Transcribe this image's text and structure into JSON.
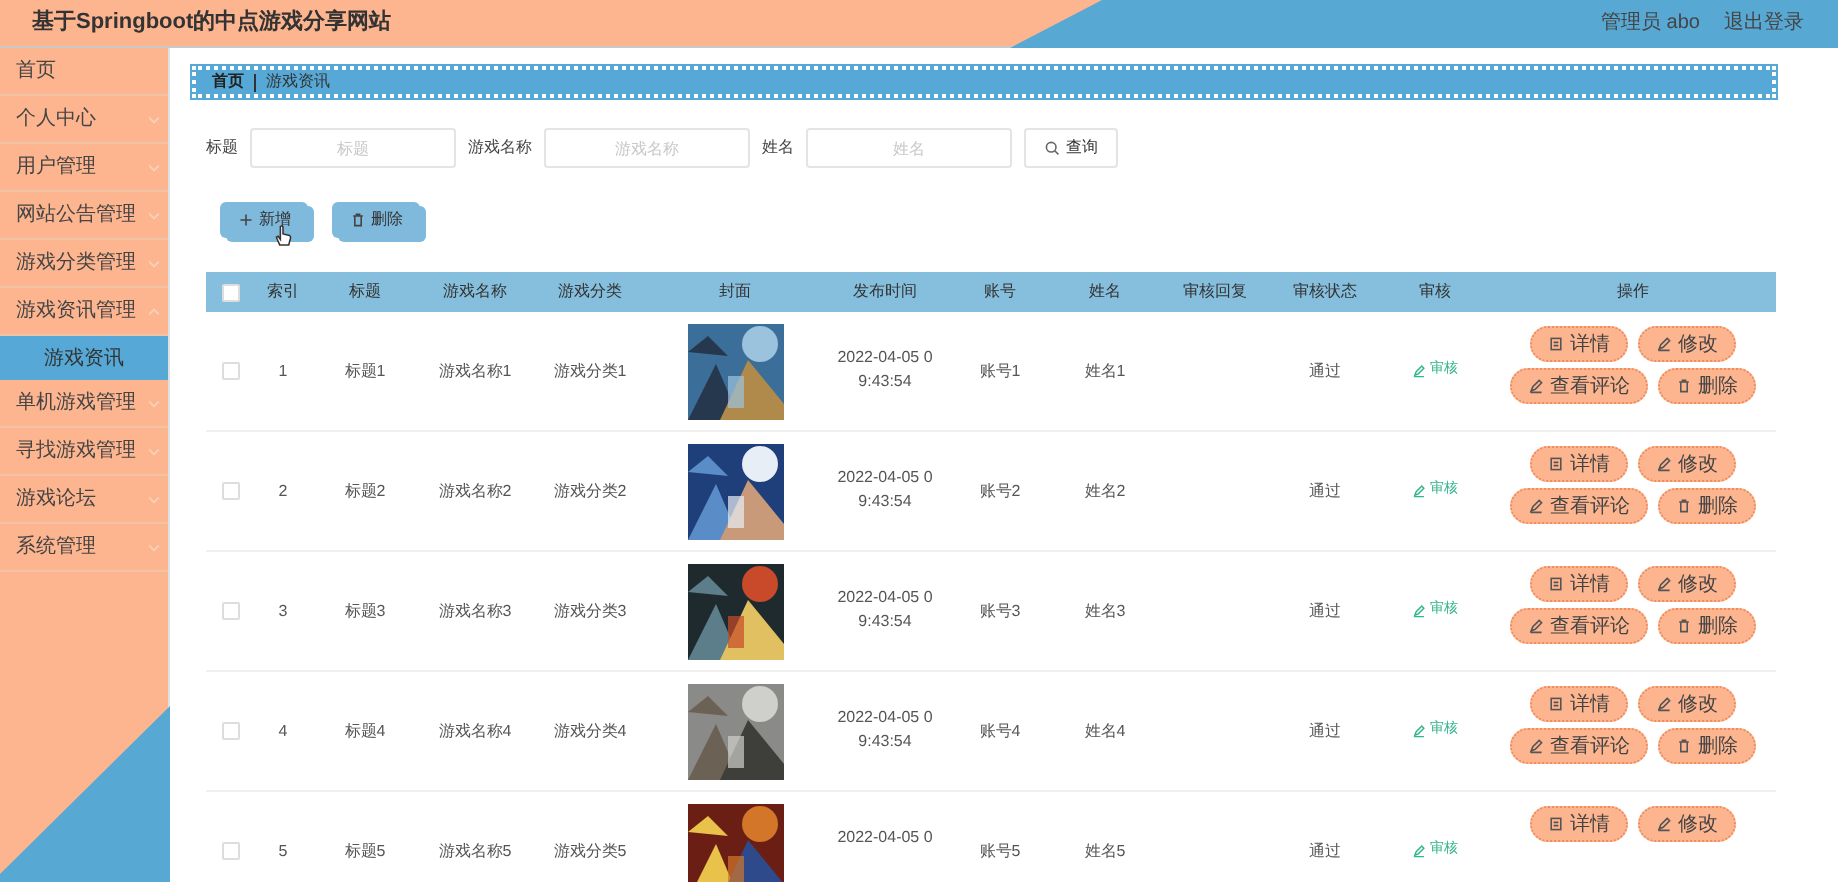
{
  "header": {
    "title": "基于Springboot的中点游戏分享网站",
    "user": "管理员 abo",
    "logout": "退出登录"
  },
  "sidebar": {
    "items": [
      {
        "label": "首页",
        "kind": "link",
        "selected": false
      },
      {
        "label": "个人中心",
        "kind": "menu",
        "expanded": false,
        "selected": false
      },
      {
        "label": "用户管理",
        "kind": "menu",
        "expanded": false,
        "selected": false
      },
      {
        "label": "网站公告管理",
        "kind": "menu",
        "expanded": false,
        "selected": false
      },
      {
        "label": "游戏分类管理",
        "kind": "menu",
        "expanded": false,
        "selected": false
      },
      {
        "label": "游戏资讯管理",
        "kind": "menu",
        "expanded": true,
        "selected": false,
        "children": [
          {
            "label": "游戏资讯",
            "selected": true
          }
        ]
      },
      {
        "label": "单机游戏管理",
        "kind": "menu",
        "expanded": false,
        "selected": false
      },
      {
        "label": "寻找游戏管理",
        "kind": "menu",
        "expanded": false,
        "selected": false
      },
      {
        "label": "游戏论坛",
        "kind": "menu",
        "expanded": false,
        "selected": false
      },
      {
        "label": "系统管理",
        "kind": "menu",
        "expanded": false,
        "selected": false
      }
    ]
  },
  "breadcrumb": [
    "首页",
    "游戏资讯"
  ],
  "search": {
    "fields": [
      {
        "label": "标题",
        "placeholder": "标题"
      },
      {
        "label": "游戏名称",
        "placeholder": "游戏名称"
      },
      {
        "label": "姓名",
        "placeholder": "姓名"
      }
    ],
    "button": "查询"
  },
  "toolbar": [
    {
      "kind": "add",
      "label": "新增"
    },
    {
      "kind": "delete",
      "label": "删除"
    }
  ],
  "table": {
    "select_all": {
      "checked": false
    },
    "columns": [
      "索引",
      "标题",
      "游戏名称",
      "游戏分类",
      "封面",
      "发布时间",
      "账号",
      "姓名",
      "审核回复",
      "审核状态",
      "审核",
      "操作"
    ],
    "rows": [
      {
        "checked": false,
        "index": "1",
        "title": "标题1",
        "game_name": "游戏名称1",
        "category": "游戏分类1",
        "cover": {
          "kind": "picture"
        },
        "date": "2022-04-05 0",
        "time": "9:43:54",
        "account": "账号1",
        "name": "姓名1",
        "status": "通过",
        "review": "审核",
        "actions": [
          {
            "kind": "detail",
            "label": "详情"
          },
          {
            "kind": "edit",
            "label": "修改"
          },
          {
            "kind": "comments",
            "label": "查看评论"
          },
          {
            "kind": "delete",
            "label": "删除"
          }
        ]
      },
      {
        "checked": false,
        "index": "2",
        "title": "标题2",
        "game_name": "游戏名称2",
        "category": "游戏分类2",
        "cover": {
          "kind": "picture"
        },
        "date": "2022-04-05 0",
        "time": "9:43:54",
        "account": "账号2",
        "name": "姓名2",
        "status": "通过",
        "review": "审核",
        "actions": [
          {
            "kind": "detail",
            "label": "详情"
          },
          {
            "kind": "edit",
            "label": "修改"
          },
          {
            "kind": "comments",
            "label": "查看评论"
          },
          {
            "kind": "delete",
            "label": "删除"
          }
        ]
      },
      {
        "checked": false,
        "index": "3",
        "title": "标题3",
        "game_name": "游戏名称3",
        "category": "游戏分类3",
        "cover": {
          "kind": "picture"
        },
        "date": "2022-04-05 0",
        "time": "9:43:54",
        "account": "账号3",
        "name": "姓名3",
        "status": "通过",
        "review": "审核",
        "actions": [
          {
            "kind": "detail",
            "label": "详情"
          },
          {
            "kind": "edit",
            "label": "修改"
          },
          {
            "kind": "comments",
            "label": "查看评论"
          },
          {
            "kind": "delete",
            "label": "删除"
          }
        ]
      },
      {
        "checked": false,
        "index": "4",
        "title": "标题4",
        "game_name": "游戏名称4",
        "category": "游戏分类4",
        "cover": {
          "kind": "picture"
        },
        "date": "2022-04-05 0",
        "time": "9:43:54",
        "account": "账号4",
        "name": "姓名4",
        "status": "通过",
        "review": "审核",
        "actions": [
          {
            "kind": "detail",
            "label": "详情"
          },
          {
            "kind": "edit",
            "label": "修改"
          },
          {
            "kind": "comments",
            "label": "查看评论"
          },
          {
            "kind": "delete",
            "label": "删除"
          }
        ]
      },
      {
        "checked": false,
        "index": "5",
        "title": "标题5",
        "game_name": "游戏名称5",
        "category": "游戏分类5",
        "cover": {
          "kind": "picture"
        },
        "date": "2022-04-05 0",
        "account": "账号5",
        "name": "姓名5",
        "status": "通过",
        "review": "审核",
        "actions": [
          {
            "kind": "detail",
            "label": "详情"
          },
          {
            "kind": "edit",
            "label": "修改"
          }
        ]
      }
    ]
  }
}
